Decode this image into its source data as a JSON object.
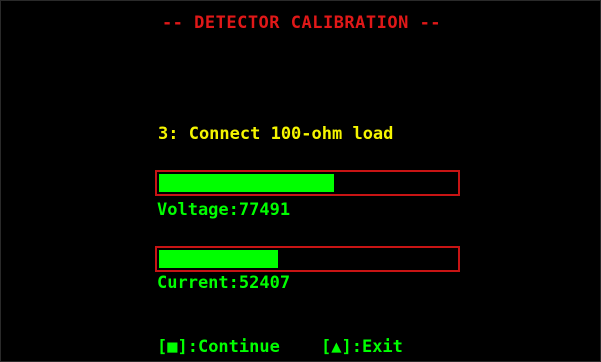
{
  "title": "-- DETECTOR CALIBRATION --",
  "step_text": "3: Connect 100-ohm load",
  "meters": [
    {
      "id": "voltage",
      "label": "Voltage",
      "value": "77491",
      "fill_fraction": 0.59
    },
    {
      "id": "current",
      "label": "Current",
      "value": "52407",
      "fill_fraction": 0.4
    }
  ],
  "hints": {
    "continue_key": "[■]",
    "continue_label": ":Continue",
    "exit_key": "[▲]",
    "exit_label": ":Exit"
  },
  "colors": {
    "background": "#000000",
    "title": "#e01818",
    "step": "#f5f500",
    "bar_fill": "#00ff00",
    "bar_border": "#c81414",
    "readout": "#00ff00"
  },
  "icons": {
    "continue": "square-key-icon",
    "exit": "triangle-up-key-icon"
  }
}
